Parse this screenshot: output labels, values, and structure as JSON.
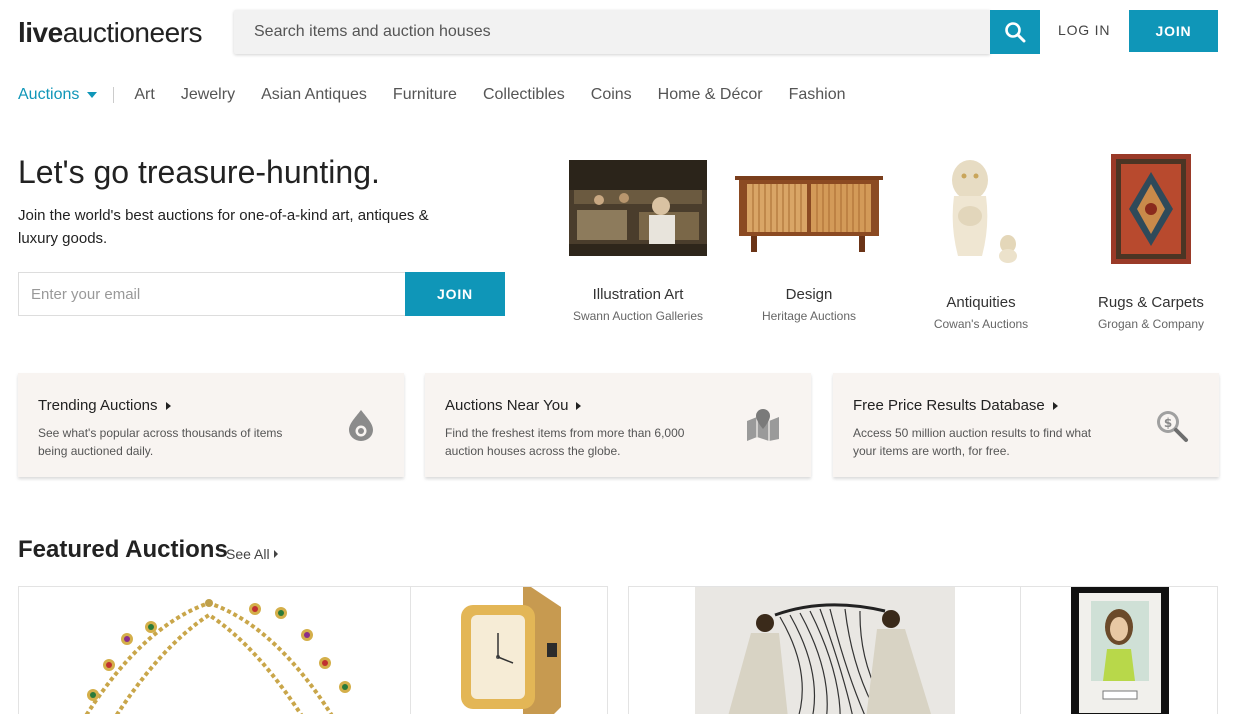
{
  "header": {
    "logo_bold": "live",
    "logo_light": "auctioneers",
    "search_placeholder": "Search items and auction houses",
    "login_label": "LOG IN",
    "join_label": "JOIN"
  },
  "nav": {
    "auctions_label": "Auctions",
    "items": [
      "Art",
      "Jewelry",
      "Asian Antiques",
      "Furniture",
      "Collectibles",
      "Coins",
      "Home & Décor",
      "Fashion"
    ]
  },
  "hero": {
    "title": "Let's go treasure-hunting.",
    "subtitle": "Join the world's best auctions for one-of-a-kind art, antiques & luxury goods.",
    "email_placeholder": "Enter your email",
    "join_label": "JOIN"
  },
  "categories": [
    {
      "name": "Illustration Art",
      "house": "Swann Auction Galleries"
    },
    {
      "name": "Design",
      "house": "Heritage Auctions"
    },
    {
      "name": "Antiquities",
      "house": "Cowan's Auctions"
    },
    {
      "name": "Rugs & Carpets",
      "house": "Grogan & Company"
    }
  ],
  "cards": [
    {
      "title": "Trending Auctions",
      "desc": "See what's popular across thousands of items being auctioned daily.",
      "icon": "flame-icon"
    },
    {
      "title": "Auctions Near You",
      "desc": "Find the freshest items from more than 6,000 auction houses across the globe.",
      "icon": "map-pin-icon"
    },
    {
      "title": "Free Price Results Database",
      "desc": "Access 50 million auction results to find what your items are worth, for free.",
      "icon": "price-search-icon"
    }
  ],
  "featured": {
    "title": "Featured Auctions",
    "see_all": "See All"
  },
  "colors": {
    "accent": "#0f96b8",
    "card_bg": "#f8f4f1"
  }
}
